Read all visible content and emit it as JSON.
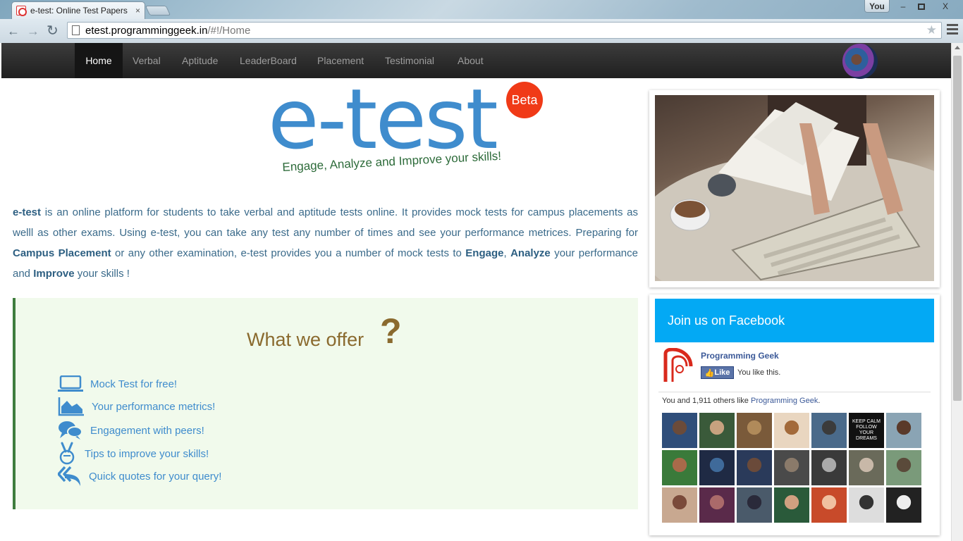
{
  "browser": {
    "tab_title": "e-test: Online Test Papers",
    "tab_close": "×",
    "profile": "You",
    "url_host": "etest.programminggeek.in",
    "url_path": "/#!/Home",
    "win_min": "–",
    "win_close": "X"
  },
  "nav": {
    "items": [
      "Home",
      "Verbal",
      "Aptitude",
      "LeaderBoard",
      "Placement",
      "Testimonial",
      "About"
    ],
    "active": "Home"
  },
  "logo": {
    "text": "e-test",
    "badge": "Beta",
    "tagline": "Engage, Analyze and Improve your skills!"
  },
  "intro": {
    "brand": "e-test",
    "p1": " is an online platform for students to take verbal and aptitude tests online. It provides mock tests for campus placements as welll as other exams. Using e-test, you can take any test any number of times and see your performance metrices. Preparing for ",
    "kw_campus": "Campus Placement",
    "p2": " or any other examination, e-test provides you a number of mock tests to ",
    "kw_engage": "Engage",
    "p3": ", ",
    "kw_analyze": "Analyze",
    "p4": " your performance and ",
    "kw_improve": "Improve",
    "p5": " your skills !"
  },
  "offer": {
    "title": "What we offer",
    "qmark": "?",
    "items": [
      {
        "label": "Mock Test for free!",
        "icon": "laptop-icon"
      },
      {
        "label": "Your performance metrics!",
        "icon": "area-chart-icon"
      },
      {
        "label": "Engagement with peers!",
        "icon": "comments-icon"
      },
      {
        "label": "Tips to improve your skills!",
        "icon": "peace-hand-icon"
      },
      {
        "label": "Quick quotes for your query!",
        "icon": "reply-all-icon"
      }
    ]
  },
  "facebook": {
    "header": "Join us on Facebook",
    "page_name": "Programming Geek",
    "like_button": "Like",
    "you_like": "You like this.",
    "count_prefix": "You and 1,911 others like ",
    "count_link": "Programming Geek",
    "count_suffix": ".",
    "friend_count": 21,
    "calm_poster": "KEEP CALM FOLLOW YOUR DREAMS"
  },
  "colors": {
    "accent_blue": "#3f8ccd",
    "beta_red": "#f03a17",
    "offer_brown": "#8a6a2e",
    "offer_bg": "#f1faec",
    "fb_header": "#03a9f4",
    "navbar": "#222222"
  }
}
